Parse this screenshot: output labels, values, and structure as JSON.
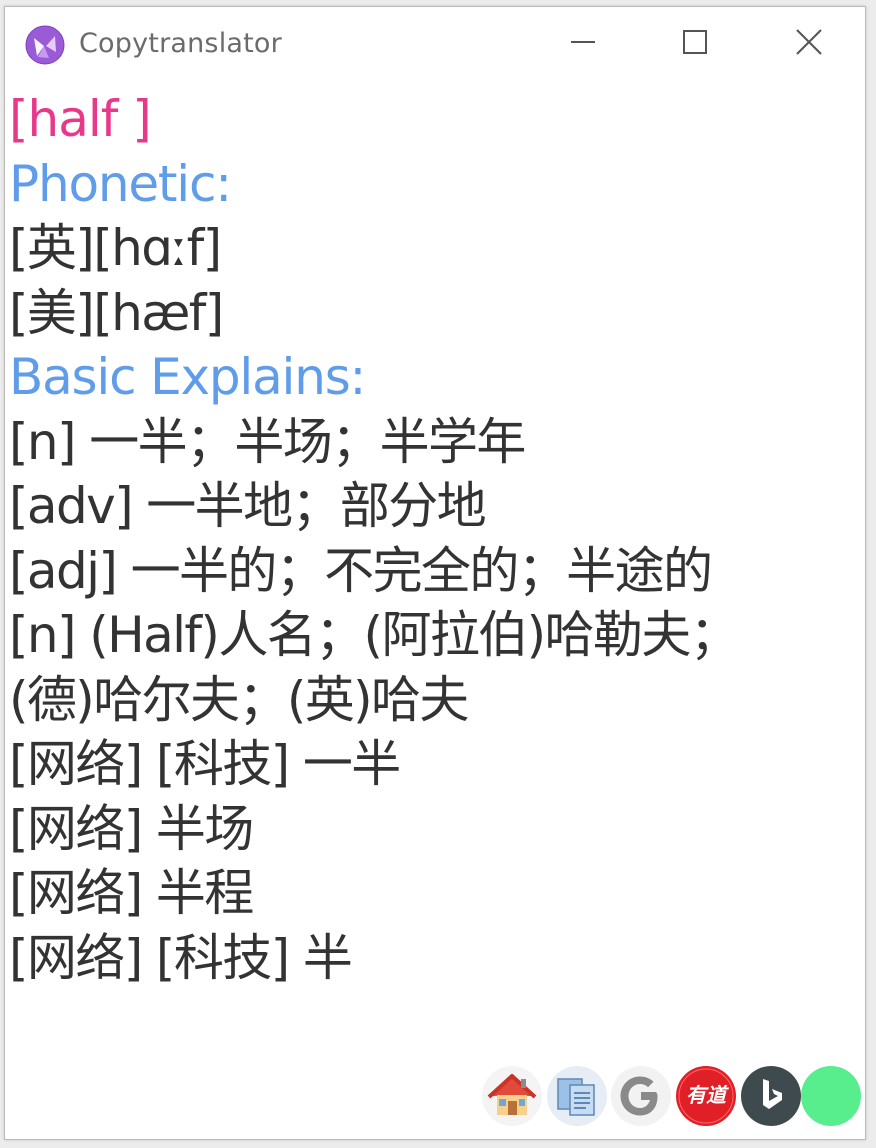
{
  "window": {
    "title": "Copytranslator"
  },
  "content": {
    "word": "[half ]",
    "phonetic_heading": "Phonetic:",
    "phonetics": [
      "[英][hɑːf]",
      "[美][hæf]"
    ],
    "basic_heading": "Basic Explains:",
    "explains": [
      "[n] 一半；半场；半学年",
      "[adv] 一半地；部分地",
      "[adj] 一半的；不完全的；半途的",
      "[n] (Half)人名；(阿拉伯)哈勒夫；",
      "(德)哈尔夫；(英)哈夫",
      "[网络] [科技] 一半",
      "[网络] 半场",
      "[网络] 半程",
      "[网络] [科技] 半"
    ]
  },
  "bottom_bar": {
    "youdao_label": "有道"
  },
  "colors": {
    "word": "#e8388a",
    "heading": "#5f9ce9",
    "text": "#333333"
  },
  "icons": [
    "app-logo-icon",
    "minimize-icon",
    "maximize-icon",
    "close-icon",
    "home-icon",
    "copy-document-icon",
    "google-icon",
    "youdao-icon",
    "bing-icon",
    "green-circle-icon"
  ]
}
